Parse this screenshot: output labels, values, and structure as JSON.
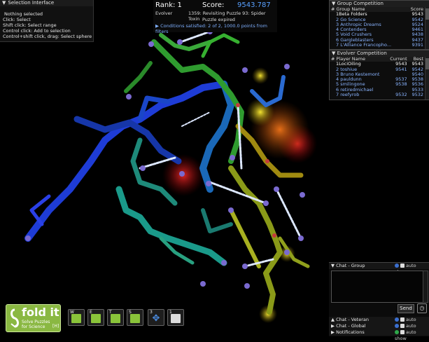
{
  "selection": {
    "title": "Selection Interface",
    "lines": [
      "Nothing selected",
      "Click: Select",
      "Shift click: Select range",
      "Control click: Add to selection",
      "Control+shift click, drag: Select sphere"
    ]
  },
  "score": {
    "rank": "Rank: 1",
    "score_label": "Score:",
    "score_value": "9543.787",
    "evolver": "Evolver",
    "puzzle": "1359: Revisiting Puzzle 93: Spider Toxin",
    "expired": "Puzzle expired",
    "conditions": "Conditions satisfied: 2 of 2, 1000.0 points from filters"
  },
  "group_board": {
    "title": "Group Competition",
    "col_name": "# Group Name",
    "col_score": "Score",
    "rows": [
      {
        "name": "1Beta Folders",
        "score": "9543"
      },
      {
        "name": "2 Go Science",
        "score": "9542"
      },
      {
        "name": "3 Anthropic Dreams",
        "score": "9524"
      },
      {
        "name": "4 Contenders",
        "score": "9461"
      },
      {
        "name": "5 Void Crushers",
        "score": "9438"
      },
      {
        "name": "6 Gargleblasters",
        "score": "9437"
      },
      {
        "name": "7 L'Alliance Francopho...",
        "score": "9391"
      }
    ]
  },
  "evolver_board": {
    "title": "Evolver Competition",
    "col_name": "# Player Name",
    "col_current": "Current",
    "col_best": "Best",
    "rows": [
      {
        "name": "1LociOiling",
        "current": "9543",
        "best": "9543"
      },
      {
        "name": "2 toshiue",
        "current": "9541",
        "best": "9542"
      },
      {
        "name": "3 Bruno Kestemont",
        "current": "",
        "best": "9540"
      },
      {
        "name": "4 pauldunn",
        "current": "9537",
        "best": "9538"
      },
      {
        "name": "5 smilingone",
        "current": "9538",
        "best": "9536"
      },
      {
        "name": "6 retiredmichael",
        "current": "",
        "best": "9533"
      },
      {
        "name": "7 reefyrob",
        "current": "9532",
        "best": "9532"
      }
    ]
  },
  "chat": {
    "group_label": "Chat - Group",
    "veteran_label": "Chat - Veteran",
    "global_label": "Chat - Global",
    "notifications_label": "Notifications",
    "auto_show": "auto show",
    "send": "Send",
    "clock_icon": "clock-icon"
  },
  "toolbar": {
    "logo_text": "fold it",
    "logo_sub1": "Solve Puzzles",
    "logo_sub2": "for Science",
    "logo_hl": "[H]",
    "tools": [
      {
        "key": "W",
        "icon": "wiggle-all-icon",
        "color": "#8ac43a"
      },
      {
        "key": "E",
        "icon": "shake-all-icon",
        "color": "#8ac43a"
      },
      {
        "key": "T",
        "icon": "tweak-icon",
        "color": "#8ac43a"
      },
      {
        "key": "S",
        "icon": "select-all-icon",
        "color": "#8ac43a"
      },
      {
        "key": "3",
        "icon": "move-icon",
        "color": "#4a8be0"
      },
      {
        "key": "1",
        "icon": "note-icon",
        "color": "#dddddd"
      }
    ]
  },
  "colors": {
    "accent": "#58a0ff",
    "link": "#8ab4ff",
    "logo_green": "#8ab842"
  }
}
